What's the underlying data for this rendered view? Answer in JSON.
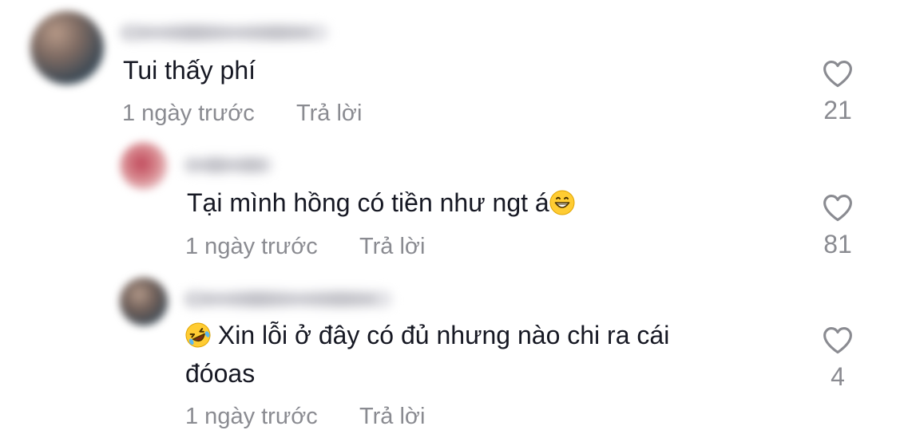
{
  "comments": [
    {
      "username": "Hoàng Minh Toàn",
      "text": "Tui thấy phí",
      "time": "1 ngày trước",
      "reply_label": "Trả lời",
      "likes": "21"
    },
    {
      "username": "Phương",
      "text": "Tại mình hồng có tiền như ngt á",
      "emoji_icon": "grinning-face-emoji",
      "time": "1 ngày trước",
      "reply_label": "Trả lời",
      "likes": "81"
    },
    {
      "username": "Hoàng Minh Toàn",
      "emoji_icon": "rolling-on-floor-laughing-emoji",
      "text_line1": "Xin lỗi ở đây có đủ nhưng nào chi ra cái",
      "text_line2": "đóoas",
      "time": "1 ngày trước",
      "reply_label": "Trả lời",
      "likes": "4"
    }
  ],
  "colors": {
    "text": "#161823",
    "muted": "#8a8b91",
    "heart_stroke": "#8a8b91"
  }
}
